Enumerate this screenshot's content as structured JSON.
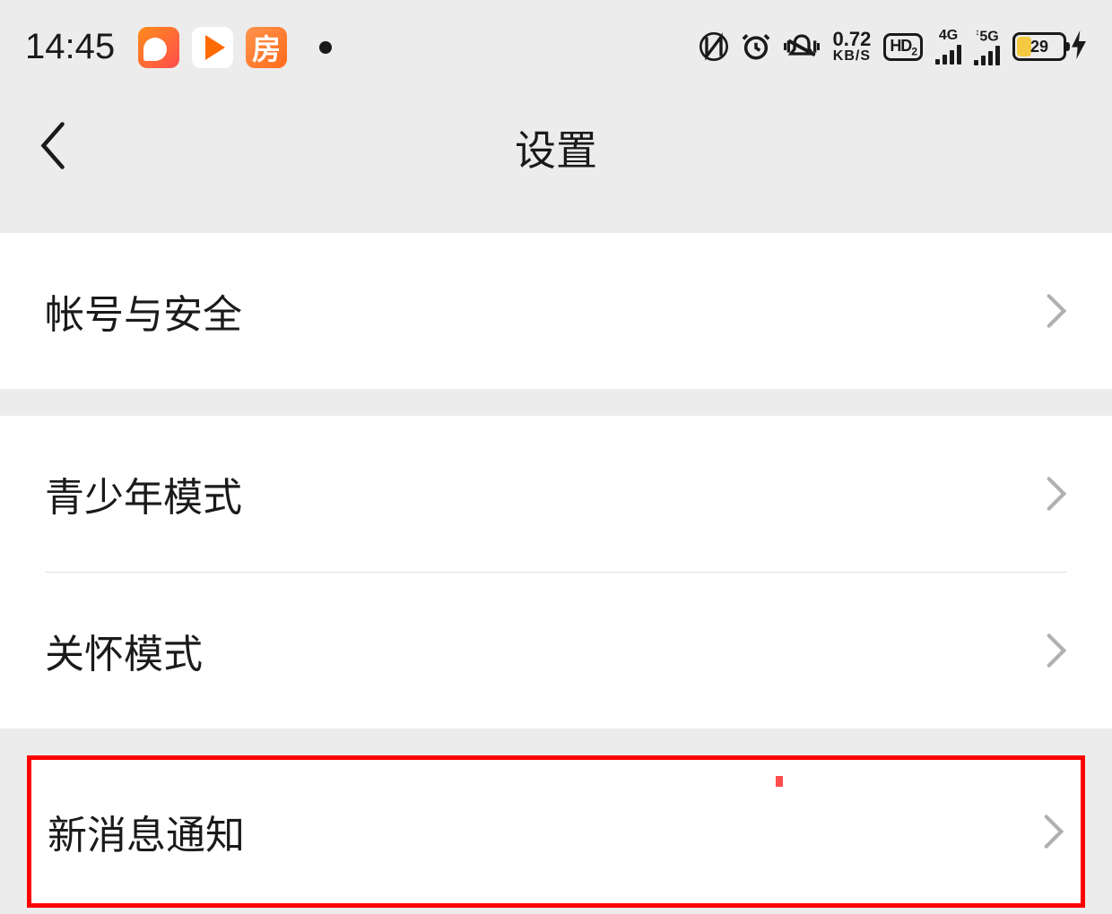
{
  "status_bar": {
    "time": "14:45",
    "app_icons": [
      "weibo",
      "video",
      "fang"
    ],
    "speed_value": "0.72",
    "speed_unit": "KB/S",
    "hd_label": "HD₂",
    "signal1_label": "4G",
    "signal2_label": "5G",
    "battery_percent": "29",
    "battery_fill_width": "29%"
  },
  "header": {
    "title": "设置"
  },
  "settings": {
    "account_security": "帐号与安全",
    "teen_mode": "青少年模式",
    "care_mode": "关怀模式",
    "new_message_notify": "新消息通知"
  }
}
